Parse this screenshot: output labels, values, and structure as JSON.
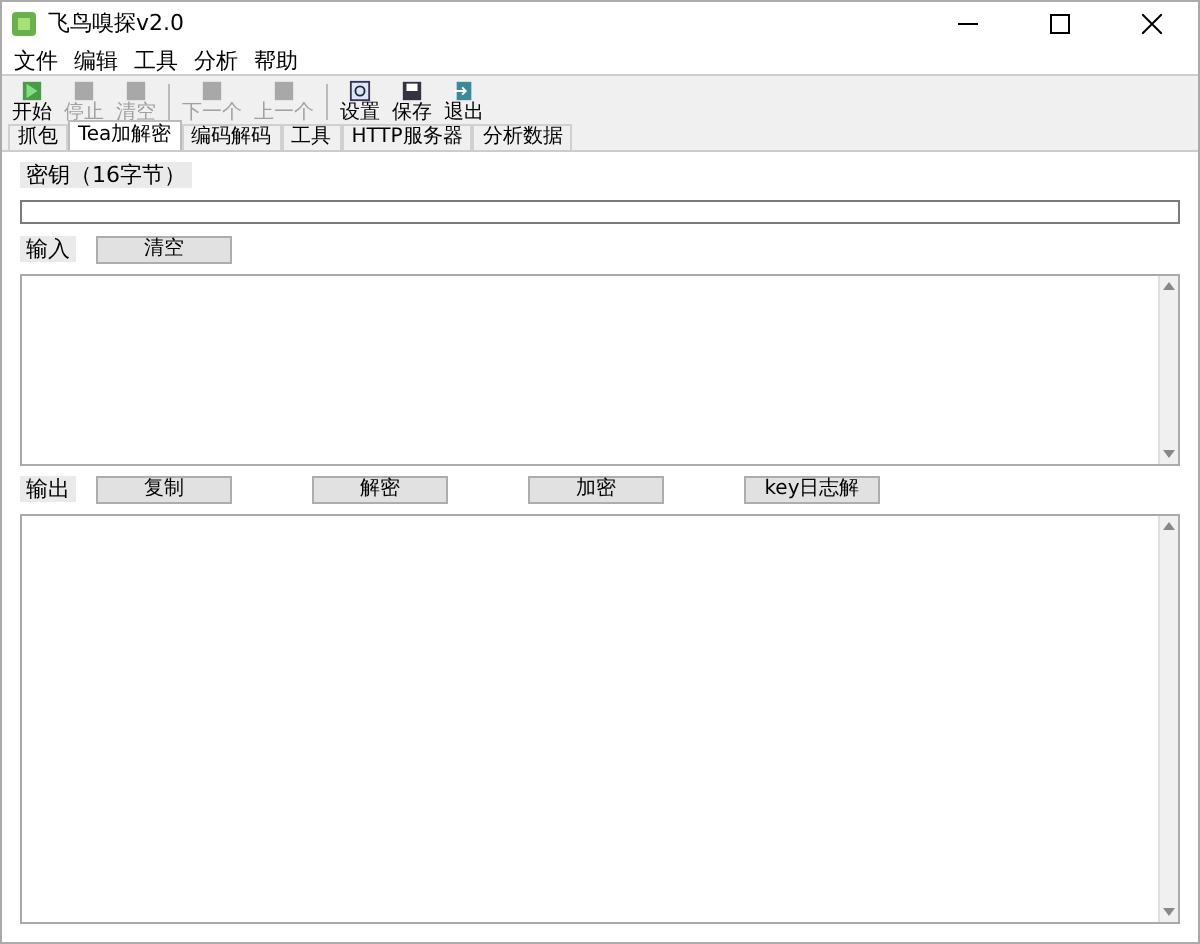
{
  "window": {
    "title": "飞鸟嗅探v2.0"
  },
  "menu": [
    "文件",
    "编辑",
    "工具",
    "分析",
    "帮助"
  ],
  "toolbar": [
    {
      "label": "开始",
      "kind": "start",
      "disabled": false
    },
    {
      "label": "停止",
      "kind": "plain",
      "disabled": true
    },
    {
      "label": "清空",
      "kind": "plain",
      "disabled": true
    },
    {
      "kind": "separator"
    },
    {
      "label": "下一个",
      "kind": "plain",
      "disabled": true
    },
    {
      "label": "上一个",
      "kind": "plain",
      "disabled": true
    },
    {
      "kind": "separator"
    },
    {
      "label": "设置",
      "kind": "settings",
      "disabled": false
    },
    {
      "label": "保存",
      "kind": "save",
      "disabled": false
    },
    {
      "label": "退出",
      "kind": "exit",
      "disabled": false
    }
  ],
  "tabs": [
    {
      "label": "抓包",
      "selected": false
    },
    {
      "label": "Tea加解密",
      "selected": true
    },
    {
      "label": "编码解码",
      "selected": false
    },
    {
      "label": "工具",
      "selected": false
    },
    {
      "label": "HTTP服务器",
      "selected": false
    },
    {
      "label": "分析数据",
      "selected": false
    }
  ],
  "key": {
    "label": "密钥（16字节）"
  },
  "input": {
    "label": "输入",
    "buttons": [
      "清空"
    ]
  },
  "output": {
    "label": "输出",
    "buttons": [
      "复制",
      "解密",
      "加密",
      "key日志解"
    ]
  }
}
